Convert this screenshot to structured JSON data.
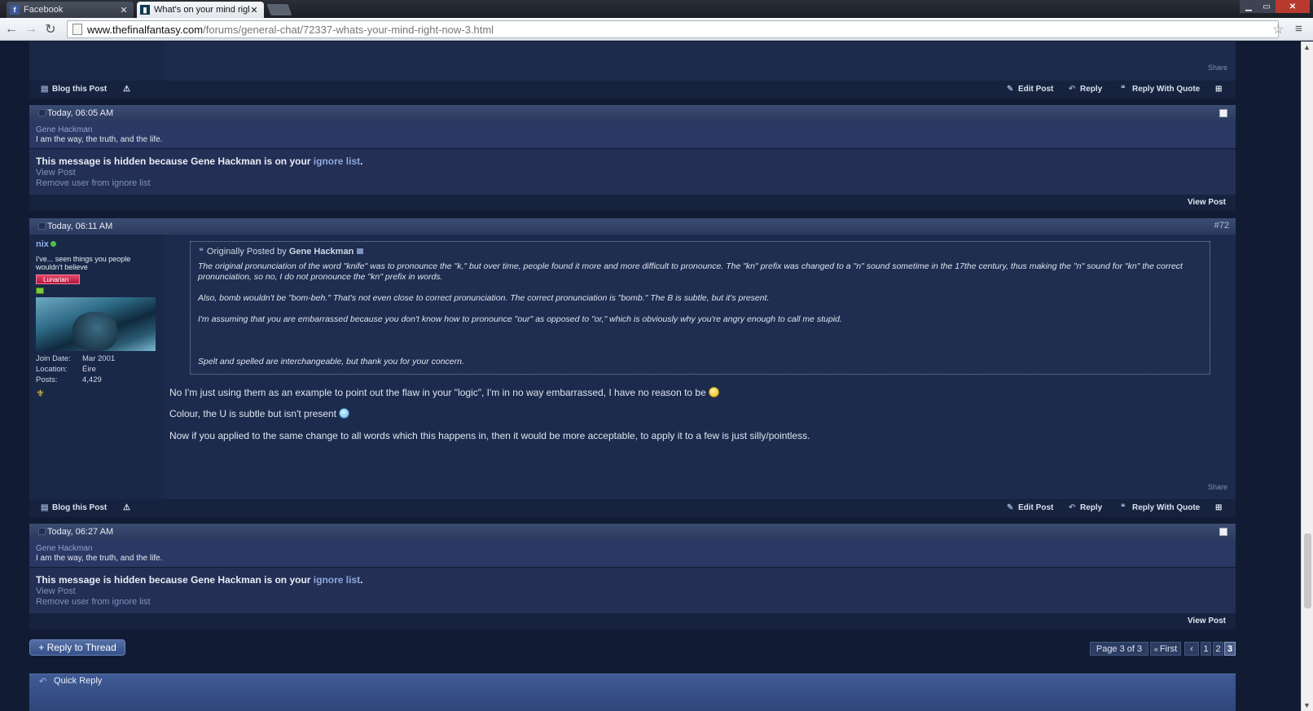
{
  "browser": {
    "tabs": [
      {
        "title": "Facebook",
        "active": false,
        "favicon": "facebook-icon"
      },
      {
        "title": "What's on your mind righ",
        "active": true,
        "favicon": "ff-icon"
      }
    ],
    "url_host": "www.thefinalfantasy.com",
    "url_path": "/forums/general-chat/72337-whats-your-mind-right-now-3.html"
  },
  "top_post": {
    "share": "Share",
    "blog": "Blog this Post",
    "edit": "Edit Post",
    "reply": "Reply",
    "reply_quote": "Reply With Quote"
  },
  "ignored_post_1": {
    "date": "Today, 06:05 AM",
    "username": "Gene Hackman",
    "usertitle": "I am the way, the truth, and the life.",
    "hidden_prefix": "This message is hidden because Gene Hackman is on your",
    "ignore_link": "ignore list",
    "hidden_suffix": ".",
    "view_post": "View Post",
    "remove_ignore": "Remove user from ignore list",
    "footer_view": "View Post"
  },
  "main_post": {
    "date": "Today, 06:11 AM",
    "number": "#72",
    "username": "nix",
    "usertitle": "I've... seen things you people wouldn't believe",
    "rank": "Lunarian",
    "join_label": "Join Date:",
    "join_value": "Mar 2001",
    "location_label": "Location:",
    "location_value": "Éire",
    "posts_label": "Posts:",
    "posts_value": "4,429",
    "quote_prefix": "Originally Posted by",
    "quote_author": "Gene Hackman",
    "quote_lines": [
      "The original pronunciation of the word \"knife\" was to pronounce the \"k,\" but over time, people found it more and more difficult to pronounce. The \"kn\" prefix was changed to a \"n\" sound sometime in the 17the century, thus making the \"n\" sound for \"kn\" the correct pronunciation, so no, I do not pronounce the \"kn\" prefix in words.",
      "Also, bomb wouldn't be \"bom-beh.\" That's not even close to correct pronunciation. The correct pronunciation is \"bomb.\" The B is subtle, but it's present.",
      "I'm assuming that you are embarrassed because you don't know how to pronounce \"our\" as opposed to \"or,\" which is obviously why you're angry enough to call me stupid.",
      "Spelt and spelled are interchangeable, but thank you for your concern."
    ],
    "message_lines": [
      "No I'm just using them as an example to point out the flaw in your \"logic\", I'm in no way embarrassed, I have no reason to be",
      "Colour, the U is subtle but isn't present",
      "Now if you applied to the same change to all words which this happens in, then it would be more acceptable, to apply it to a few is just silly/pointless."
    ],
    "share": "Share",
    "blog": "Blog this Post",
    "edit": "Edit Post",
    "reply": "Reply",
    "reply_quote": "Reply With Quote"
  },
  "ignored_post_2": {
    "date": "Today, 06:27 AM",
    "username": "Gene Hackman",
    "usertitle": "I am the way, the truth, and the life.",
    "hidden_prefix": "This message is hidden because Gene Hackman is on your",
    "ignore_link": "ignore list",
    "hidden_suffix": ".",
    "view_post": "View Post",
    "remove_ignore": "Remove user from ignore list",
    "footer_view": "View Post"
  },
  "pagination": {
    "reply_button": "+ Reply to Thread",
    "page_label": "Page 3 of 3",
    "first": "First",
    "prev": "‹",
    "pages": [
      "1",
      "2",
      "3"
    ],
    "current": "3"
  },
  "quick_reply": "Quick Reply"
}
